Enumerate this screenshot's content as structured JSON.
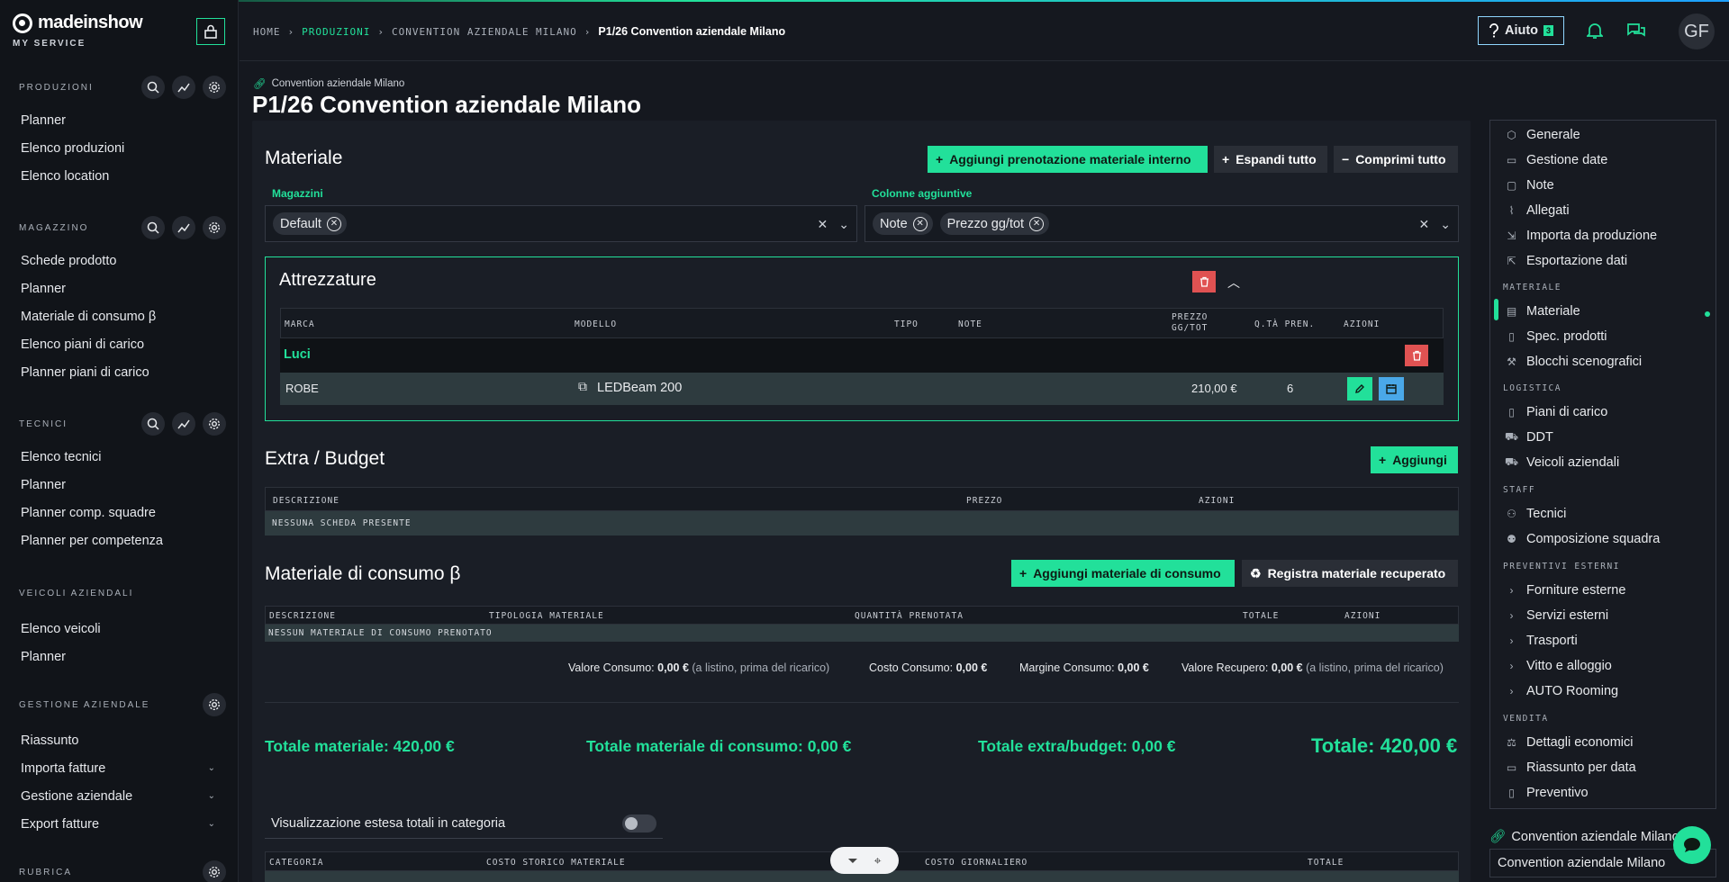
{
  "brand": {
    "name": "madeinshow",
    "subtitle": "MY SERVICE"
  },
  "breadcrumbs": [
    "HOME",
    "PRODUZIONI",
    "CONVENTION AZIENDALE MILANO",
    "P1/26 Convention aziendale Milano"
  ],
  "header": {
    "help_label": "Aiuto",
    "help_badge": "3",
    "avatar_initials": "GF"
  },
  "sidebar": {
    "produzioni": {
      "title": "PRODUZIONI",
      "items": [
        "Planner",
        "Elenco produzioni",
        "Elenco location"
      ]
    },
    "magazzino": {
      "title": "MAGAZZINO",
      "items": [
        "Schede prodotto",
        "Planner",
        "Materiale di consumo β",
        "Elenco piani di carico",
        "Planner piani di carico"
      ]
    },
    "tecnici": {
      "title": "TECNICI",
      "items": [
        "Elenco tecnici",
        "Planner",
        "Planner comp. squadre",
        "Planner per competenza"
      ]
    },
    "veicoli": {
      "title": "VEICOLI AZIENDALI",
      "items": [
        "Elenco veicoli",
        "Planner"
      ]
    },
    "gestione": {
      "title": "GESTIONE AZIENDALE",
      "items": [
        "Riassunto",
        "Importa fatture",
        "Gestione aziendale",
        "Export fatture"
      ]
    },
    "rubrica": {
      "title": "RUBRICA"
    }
  },
  "page": {
    "pre_title": "Convention aziendale Milano",
    "title": "P1/26 Convention aziendale Milano"
  },
  "materiale": {
    "title": "Materiale",
    "btn_add": "Aggiungi prenotazione materiale interno",
    "btn_expand": "Espandi tutto",
    "btn_collapse": "Comprimi tutto",
    "magazzini_label": "Magazzini",
    "magazzini_chips": [
      "Default"
    ],
    "colonne_label": "Colonne aggiuntive",
    "colonne_chips": [
      "Note",
      "Prezzo gg/tot"
    ]
  },
  "attrezzature": {
    "title": "Attrezzature",
    "headers": {
      "marca": "MARCA",
      "modello": "MODELLO",
      "tipo": "TIPO",
      "note": "NOTE",
      "prezzo": "PREZZO GG/TOT",
      "qta": "Q.TÀ PREN.",
      "azioni": "AZIONI"
    },
    "group": "Luci",
    "row": {
      "marca": "ROBE",
      "modello": "LEDBeam 200",
      "prezzo": "210,00 €",
      "qta": "6"
    }
  },
  "extra": {
    "title": "Extra / Budget",
    "btn_add": "Aggiungi",
    "headers": {
      "descrizione": "DESCRIZIONE",
      "prezzo": "PREZZO",
      "azioni": "AZIONI"
    },
    "empty": "NESSUNA SCHEDA PRESENTE"
  },
  "consumo": {
    "title": "Materiale di consumo β",
    "btn_add": "Aggiungi materiale di consumo",
    "btn_recover": "Registra materiale recuperato",
    "headers": {
      "descrizione": "DESCRIZIONE",
      "tipologia": "TIPOLOGIA MATERIALE",
      "quantita": "QUANTITÀ PRENOTATA",
      "totale": "TOTALE",
      "azioni": "AZIONI"
    },
    "empty": "NESSUN MATERIALE DI CONSUMO PRENOTATO",
    "valore_label": "Valore Consumo:",
    "valore": "0,00 €",
    "valore_note": "(a listino, prima del ricarico)",
    "costo_label": "Costo Consumo:",
    "costo": "0,00 €",
    "margine_label": "Margine Consumo:",
    "margine": "0,00 €",
    "recupero_label": "Valore Recupero:",
    "recupero": "0,00 €",
    "recupero_note": "(a listino, prima del ricarico)"
  },
  "totals": {
    "materiale": "Totale materiale: 420,00 €",
    "consumo": "Totale materiale di consumo: 0,00 €",
    "extra": "Totale extra/budget: 0,00 €",
    "totale": "Totale: 420,00 €",
    "toggle_label": "Visualizzazione estesa totali in categoria",
    "headers": {
      "categoria": "CATEGORIA",
      "costo_storico": "COSTO STORICO MATERIALE",
      "costo_giornaliero": "COSTO GIORNALIERO",
      "totale": "TOTALE"
    }
  },
  "right_nav": {
    "top": [
      "Generale",
      "Gestione date",
      "Note",
      "Allegati",
      "Importa da produzione",
      "Esportazione dati"
    ],
    "materiale_head": "MATERIALE",
    "materiale": [
      "Materiale",
      "Spec. prodotti",
      "Blocchi scenografici"
    ],
    "logistica_head": "LOGISTICA",
    "logistica": [
      "Piani di carico",
      "DDT",
      "Veicoli aziendali"
    ],
    "staff_head": "STAFF",
    "staff": [
      "Tecnici",
      "Composizione squadra"
    ],
    "preventivi_head": "PREVENTIVI ESTERNI",
    "preventivi": [
      "Forniture esterne",
      "Servizi esterni",
      "Trasporti",
      "Vitto e alloggio",
      "AUTO Rooming"
    ],
    "vendita_head": "VENDITA",
    "vendita": [
      "Dettagli economici",
      "Riassunto per data",
      "Preventivo"
    ]
  },
  "project_switch": {
    "link": "Convention aziendale Milano",
    "selected": "Convention aziendale Milano"
  },
  "colors": {
    "accent": "#22e09a",
    "danger": "#e05252",
    "info": "#4aa8e8",
    "bg": "#15181f"
  }
}
